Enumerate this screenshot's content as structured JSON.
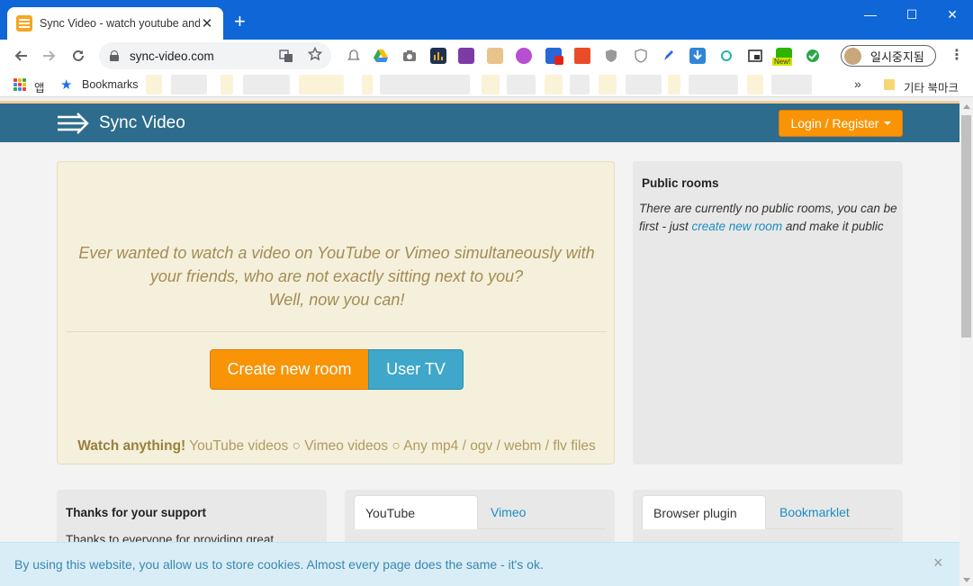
{
  "browser": {
    "tab_title": "Sync Video - watch youtube and",
    "tab_close": "✕",
    "new_tab": "+",
    "url": "sync-video.com",
    "profile_label": "일시중지됨",
    "window_controls": [
      "—",
      "☐",
      "✕"
    ],
    "extension_badge": "New!",
    "accent_color": "#0f66d6"
  },
  "bookmarks_bar": {
    "apps_label": "앱",
    "bookmarks_label": "Bookmarks",
    "overflow": "»",
    "other_bookmarks": "기타 북마크"
  },
  "site": {
    "brand": "Sync Video",
    "login_label": "Login / Register",
    "hero": {
      "line1": "Ever wanted to watch a video on YouTube or Vimeo simultaneously with",
      "line2": "your friends, who are not exactly sitting next to you?",
      "line3": "Well, now you can!",
      "create_room": "Create new room",
      "user_tv": "User TV",
      "features_lead": "Watch anything!",
      "features_rest": " YouTube videos ○ Vimeo videos ○ Any mp4 / ogv / webm / flv files"
    },
    "public_rooms": {
      "title": "Public rooms",
      "text_before": "There are currently no public rooms, you can be first - just ",
      "link": "create new room",
      "text_after": " and make it public"
    },
    "support": {
      "title": "Thanks for your support",
      "text": "Thanks to everyone for providing great"
    },
    "video_tabs": {
      "active": "YouTube",
      "other": "Vimeo"
    },
    "plugin_tabs": {
      "active": "Browser plugin",
      "other": "Bookmarklet"
    },
    "cookie_notice": {
      "text": "By using this website, you allow us to store cookies. Almost every page does the same - it's ok.",
      "close": "×"
    },
    "colors": {
      "navbar": "#2d6c8c",
      "orange": "#f89406",
      "blue_button": "#3fa7c9",
      "hero_bg": "#f4f0dc",
      "link": "#1a8dc4"
    }
  }
}
